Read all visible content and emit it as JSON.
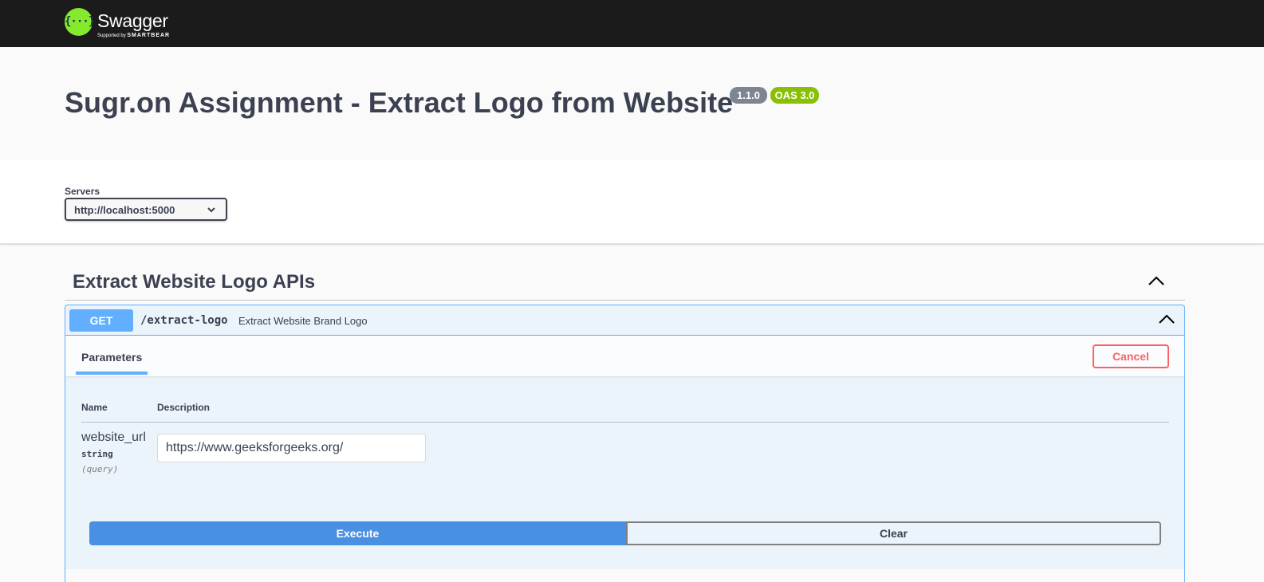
{
  "topbar": {
    "brand": "Swagger",
    "brand_tm": ".",
    "supported_by": "Supported by",
    "smartbear": "SMARTBEAR",
    "logo_glyph": "{···}"
  },
  "info": {
    "title": "Sugr.on Assignment - Extract Logo from Website",
    "version_badge": "1.1.0",
    "oas_badge": "OAS 3.0"
  },
  "servers": {
    "label": "Servers",
    "selected": "http://localhost:5000"
  },
  "tag": {
    "title": "Extract Website Logo APIs"
  },
  "operation": {
    "method": "GET",
    "path": "/extract-logo",
    "summary": "Extract Website Brand Logo",
    "tab_label": "Parameters",
    "cancel_label": "Cancel",
    "columns": {
      "name": "Name",
      "description": "Description"
    },
    "parameter": {
      "name": "website_url",
      "type": "string",
      "in": "(query)",
      "value": "https://www.geeksforgeeks.org/"
    },
    "execute_label": "Execute",
    "clear_label": "Clear"
  },
  "colors": {
    "topbar": "#1b1b1b",
    "swagger_green": "#85ea2d",
    "get_blue": "#61affe",
    "execute_blue": "#4990e2",
    "cancel_red": "#ff6060",
    "badge_grey": "#7d8492",
    "badge_green": "#89bf04"
  }
}
